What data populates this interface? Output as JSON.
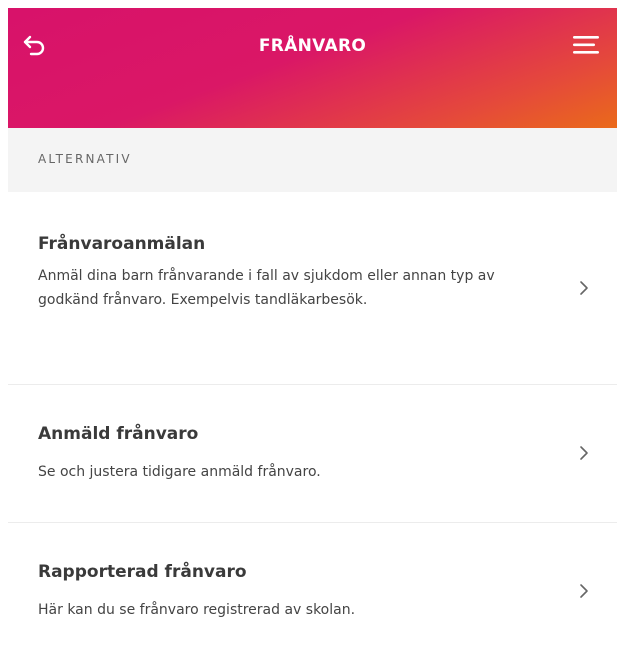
{
  "header": {
    "title": "FRÅNVARO",
    "back_icon": "back-arrow-icon",
    "menu_icon": "hamburger-menu-icon",
    "gradient_colors": [
      "#d8126a",
      "#ea6a1a"
    ]
  },
  "section": {
    "label": "ALTERNATIV"
  },
  "items": [
    {
      "title": "Frånvaroanmälan",
      "description": "Anmäl dina barn frånvarande i fall av sjukdom eller annan typ av godkänd frånvaro. Exempelvis tandläkarbesök."
    },
    {
      "title": "Anmäld frånvaro",
      "description": "Se och justera tidigare anmäld frånvaro."
    },
    {
      "title": "Rapporterad frånvaro",
      "description": "Här kan du se frånvaro registrerad av skolan."
    }
  ]
}
